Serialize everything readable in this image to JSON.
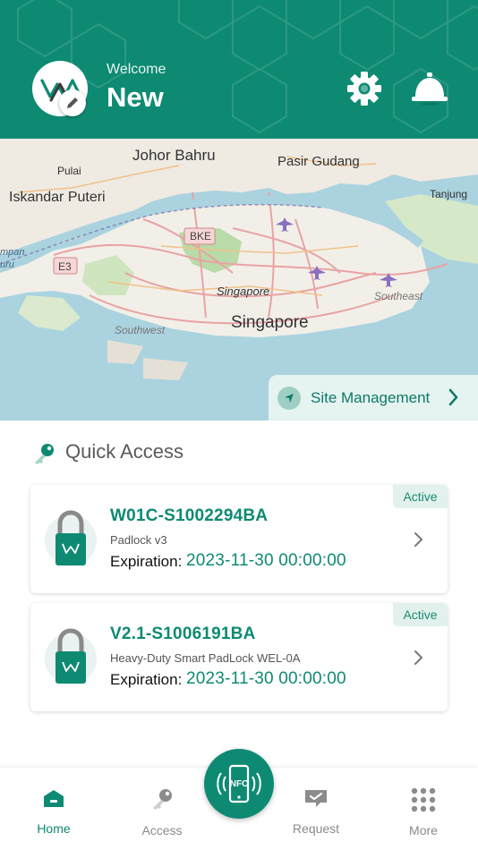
{
  "colors": {
    "brand": "#0e8a73",
    "brand_light": "#e2f1ed"
  },
  "header": {
    "welcome": "Welcome",
    "username": "New"
  },
  "map": {
    "labels": {
      "johor_bahru": "Johor Bahru",
      "pasir_gudang": "Pasir Gudang",
      "pulai": "Pulai",
      "iskandar_puteri": "Iskandar Puteri",
      "tanjung": "Tanjung",
      "bke": "BKE",
      "e3": "E3",
      "singapore_small": "Singapore",
      "singapore_big": "Singapore",
      "southwest": "Southwest",
      "southeast": "Southeast",
      "kampung_a": "mpan",
      "kampung_b": "uru"
    },
    "site_management_label": "Site Management"
  },
  "quick_access": {
    "title": "Quick Access",
    "items": [
      {
        "name": "W01C-S1002294BA",
        "model": "Padlock v3",
        "expiration_label": "Expiration:",
        "expiration": "2023-11-30 00:00:00",
        "status": "Active"
      },
      {
        "name": "V2.1-S1006191BA",
        "model": "Heavy-Duty Smart PadLock WEL-0A",
        "expiration_label": "Expiration:",
        "expiration": "2023-11-30 00:00:00",
        "status": "Active"
      }
    ]
  },
  "bottom_nav": {
    "items": [
      {
        "label": "Home",
        "icon": "home-icon",
        "active": true
      },
      {
        "label": "Access",
        "icon": "key-icon",
        "active": false
      },
      {
        "label": "Request",
        "icon": "request-icon",
        "active": false
      },
      {
        "label": "More",
        "icon": "grid-icon",
        "active": false
      }
    ],
    "nfc_label": "NFC"
  }
}
